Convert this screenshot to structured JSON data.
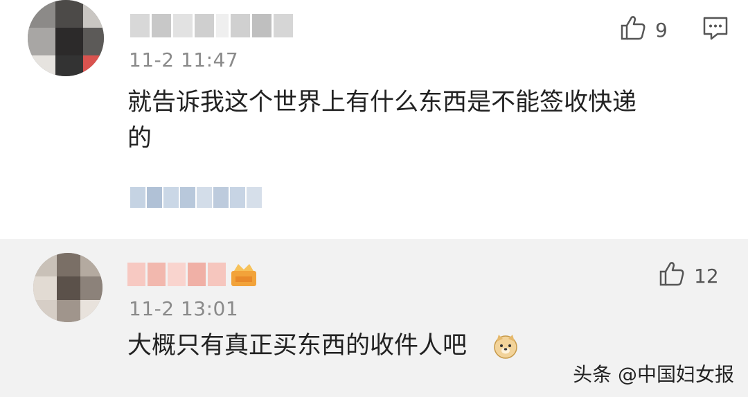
{
  "comments": [
    {
      "timestamp": "11-2 11:47",
      "text_line1": "就告诉我这个世界上有什么东西是不能签收快递",
      "text_line2": "的",
      "likes": "9"
    },
    {
      "timestamp": "11-2 13:01",
      "text": "大概只有真正买东西的收件人吧",
      "emoji": "🐶",
      "likes": "12"
    }
  ],
  "watermark": "头条 @中国妇女报",
  "icons": {
    "like": "thumb-up-icon",
    "reply": "comment-icon",
    "emoji": "doge-emoji-icon",
    "badge": "crown-badge-icon"
  }
}
